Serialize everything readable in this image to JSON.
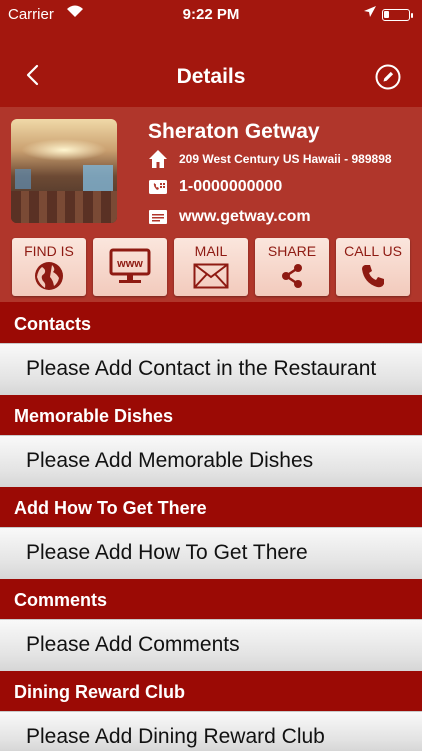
{
  "status_bar": {
    "carrier": "Carrier",
    "time": "9:22 PM"
  },
  "nav": {
    "title": "Details",
    "back_icon": "chevron-left-icon",
    "edit_icon": "pencil-circle-icon"
  },
  "restaurant": {
    "name": "Sheraton Getway",
    "address": "209 West Century US Hawaii - 989898",
    "phone": "1-0000000000",
    "website": "www.getway.com"
  },
  "actions": [
    {
      "label": "FIND IS",
      "icon": "globe-icon"
    },
    {
      "label": "",
      "icon": "www-monitor-icon"
    },
    {
      "label": "MAIL",
      "icon": "envelope-icon"
    },
    {
      "label": "SHARE",
      "icon": "share-icon"
    },
    {
      "label": "CALL US",
      "icon": "phone-icon"
    }
  ],
  "sections": [
    {
      "title": "Contacts",
      "placeholder": "Please Add Contact in the Restaurant"
    },
    {
      "title": "Memorable Dishes",
      "placeholder": "Please Add Memorable Dishes"
    },
    {
      "title": "Add How To Get There",
      "placeholder": "Please Add How To Get There"
    },
    {
      "title": "Comments",
      "placeholder": "Please Add Comments"
    },
    {
      "title": "Dining Reward Club",
      "placeholder": "Please Add Dining Reward Club"
    }
  ],
  "colors": {
    "background": "#9b0a05",
    "bar": "#a3170e",
    "header": "#b0362b",
    "button": "#f2cabc",
    "button_text": "#8e1a12"
  }
}
